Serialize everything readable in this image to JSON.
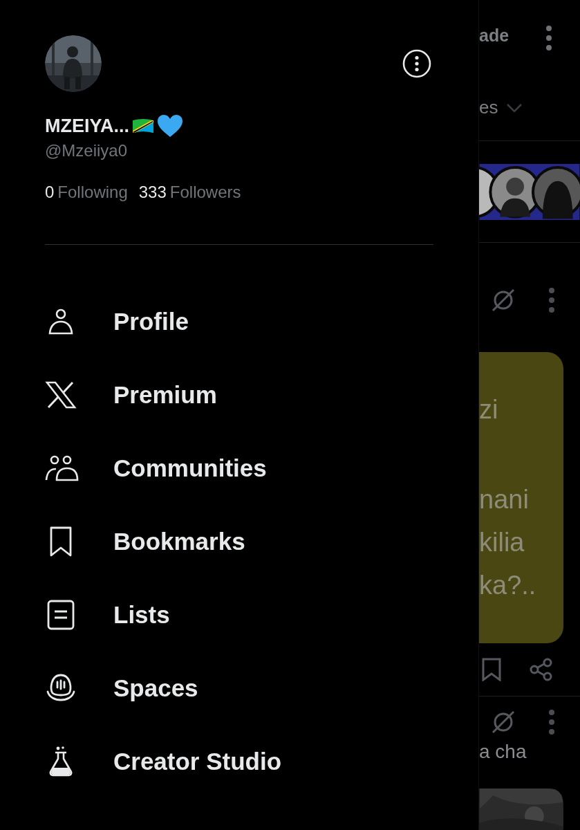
{
  "drawer": {
    "name": "MZEIYA...",
    "handle": "@Mzeiiya0",
    "stats": [
      {
        "count": "0",
        "label": "Following"
      },
      {
        "count": "333",
        "label": "Followers"
      }
    ],
    "menu": [
      {
        "label": "Profile"
      },
      {
        "label": "Premium"
      },
      {
        "label": "Communities"
      },
      {
        "label": "Bookmarks"
      },
      {
        "label": "Lists"
      },
      {
        "label": "Spaces"
      },
      {
        "label": "Creator Studio"
      }
    ]
  },
  "background_feed": {
    "header_text": "ade",
    "filter_text": "es",
    "post_lines": [
      "zi",
      "nani",
      "kilia",
      "ka?.."
    ],
    "next_post_text": "a cha"
  }
}
